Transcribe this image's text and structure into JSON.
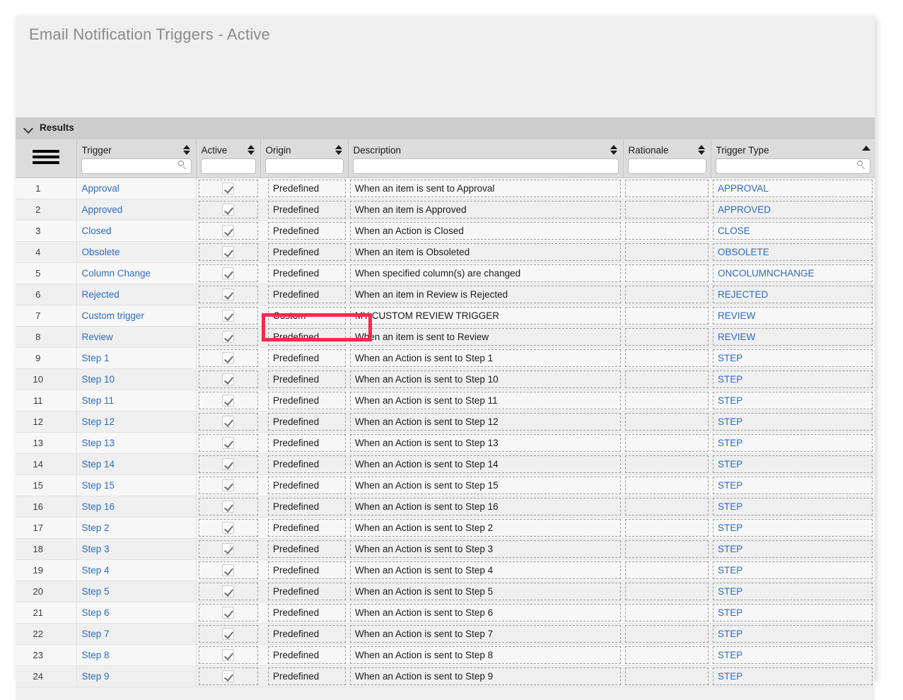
{
  "page": {
    "title": "Email Notification Triggers - Active",
    "background_color": "#ffffff",
    "card_color": "#efefef"
  },
  "results_panel": {
    "label": "Results",
    "collapse_icon": "chevron-down-icon",
    "menu_icon": "hamburger-menu-icon"
  },
  "columns": [
    {
      "key": "trigger",
      "label": "Trigger",
      "sort": "both",
      "filter_value": "",
      "filter_has_search": true
    },
    {
      "key": "active",
      "label": "Active",
      "sort": "both",
      "filter_value": "",
      "filter_has_search": false
    },
    {
      "key": "origin",
      "label": "Origin",
      "sort": "both",
      "filter_value": "",
      "filter_has_search": false
    },
    {
      "key": "description",
      "label": "Description",
      "sort": "both",
      "filter_value": "",
      "filter_has_search": false
    },
    {
      "key": "rationale",
      "label": "Rationale",
      "sort": "both",
      "filter_value": "",
      "filter_has_search": false
    },
    {
      "key": "trigger_type",
      "label": "Trigger Type",
      "sort": "asc",
      "filter_value": "",
      "filter_has_search": true
    }
  ],
  "rows": [
    {
      "num": "1",
      "trigger": "Approval",
      "active": true,
      "origin": "Predefined",
      "description": "When an item is sent to Approval",
      "rationale": "",
      "trigger_type": "APPROVAL"
    },
    {
      "num": "2",
      "trigger": "Approved",
      "active": true,
      "origin": "Predefined",
      "description": "When an item is Approved",
      "rationale": "",
      "trigger_type": "APPROVED"
    },
    {
      "num": "3",
      "trigger": "Closed",
      "active": true,
      "origin": "Predefined",
      "description": "When an Action is Closed",
      "rationale": "",
      "trigger_type": "CLOSE"
    },
    {
      "num": "4",
      "trigger": "Obsolete",
      "active": true,
      "origin": "Predefined",
      "description": "When an item is Obsoleted",
      "rationale": "",
      "trigger_type": "OBSOLETE"
    },
    {
      "num": "5",
      "trigger": "Column Change",
      "active": true,
      "origin": "Predefined",
      "description": "When specified column(s) are changed",
      "rationale": "",
      "trigger_type": "ONCOLUMNCHANGE"
    },
    {
      "num": "6",
      "trigger": "Rejected",
      "active": true,
      "origin": "Predefined",
      "description": "When an item in Review is Rejected",
      "rationale": "",
      "trigger_type": "REJECTED"
    },
    {
      "num": "7",
      "trigger": "Custom trigger",
      "active": true,
      "origin": "Custom",
      "description": "MY CUSTOM REVIEW TRIGGER",
      "rationale": "",
      "trigger_type": "REVIEW"
    },
    {
      "num": "8",
      "trigger": "Review",
      "active": true,
      "origin": "Predefined",
      "description": "When an item is sent to Review",
      "rationale": "",
      "trigger_type": "REVIEW"
    },
    {
      "num": "9",
      "trigger": "Step 1",
      "active": true,
      "origin": "Predefined",
      "description": "When an Action is sent to Step 1",
      "rationale": "",
      "trigger_type": "STEP"
    },
    {
      "num": "10",
      "trigger": "Step 10",
      "active": true,
      "origin": "Predefined",
      "description": "When an Action is sent to Step 10",
      "rationale": "",
      "trigger_type": "STEP"
    },
    {
      "num": "11",
      "trigger": "Step 11",
      "active": true,
      "origin": "Predefined",
      "description": "When an Action is sent to Step 11",
      "rationale": "",
      "trigger_type": "STEP"
    },
    {
      "num": "12",
      "trigger": "Step 12",
      "active": true,
      "origin": "Predefined",
      "description": "When an Action is sent to Step 12",
      "rationale": "",
      "trigger_type": "STEP"
    },
    {
      "num": "13",
      "trigger": "Step 13",
      "active": true,
      "origin": "Predefined",
      "description": "When an Action is sent to Step 13",
      "rationale": "",
      "trigger_type": "STEP"
    },
    {
      "num": "14",
      "trigger": "Step 14",
      "active": true,
      "origin": "Predefined",
      "description": "When an Action is sent to Step 14",
      "rationale": "",
      "trigger_type": "STEP"
    },
    {
      "num": "15",
      "trigger": "Step 15",
      "active": true,
      "origin": "Predefined",
      "description": "When an Action is sent to Step 15",
      "rationale": "",
      "trigger_type": "STEP"
    },
    {
      "num": "16",
      "trigger": "Step 16",
      "active": true,
      "origin": "Predefined",
      "description": "When an Action is sent to Step 16",
      "rationale": "",
      "trigger_type": "STEP"
    },
    {
      "num": "17",
      "trigger": "Step 2",
      "active": true,
      "origin": "Predefined",
      "description": "When an Action is sent to Step 2",
      "rationale": "",
      "trigger_type": "STEP"
    },
    {
      "num": "18",
      "trigger": "Step 3",
      "active": true,
      "origin": "Predefined",
      "description": "When an Action is sent to Step 3",
      "rationale": "",
      "trigger_type": "STEP"
    },
    {
      "num": "19",
      "trigger": "Step 4",
      "active": true,
      "origin": "Predefined",
      "description": "When an Action is sent to Step 4",
      "rationale": "",
      "trigger_type": "STEP"
    },
    {
      "num": "20",
      "trigger": "Step 5",
      "active": true,
      "origin": "Predefined",
      "description": "When an Action is sent to Step 5",
      "rationale": "",
      "trigger_type": "STEP"
    },
    {
      "num": "21",
      "trigger": "Step 6",
      "active": true,
      "origin": "Predefined",
      "description": "When an Action is sent to Step 6",
      "rationale": "",
      "trigger_type": "STEP"
    },
    {
      "num": "22",
      "trigger": "Step 7",
      "active": true,
      "origin": "Predefined",
      "description": "When an Action is sent to Step 7",
      "rationale": "",
      "trigger_type": "STEP"
    },
    {
      "num": "23",
      "trigger": "Step 8",
      "active": true,
      "origin": "Predefined",
      "description": "When an Action is sent to Step 8",
      "rationale": "",
      "trigger_type": "STEP"
    },
    {
      "num": "24",
      "trigger": "Step 9",
      "active": true,
      "origin": "Predefined",
      "description": "When an Action is sent to Step 9",
      "rationale": "",
      "trigger_type": "STEP"
    }
  ],
  "annotation": {
    "highlight_color": "#f52a51",
    "target_row": "7",
    "target_column": "origin",
    "target_value": "Custom"
  }
}
